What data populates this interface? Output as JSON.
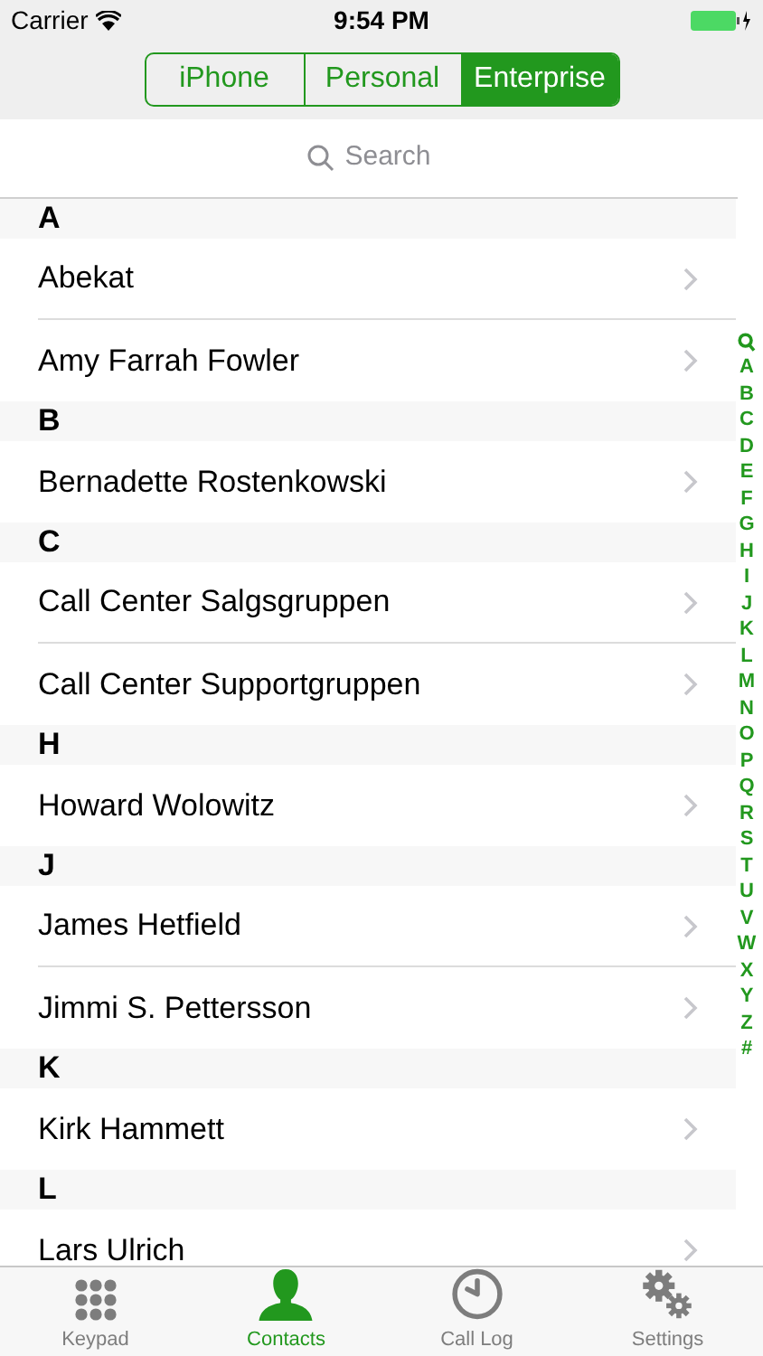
{
  "status_bar": {
    "carrier": "Carrier",
    "time": "9:54 PM"
  },
  "segments": [
    {
      "label": "iPhone",
      "selected": false
    },
    {
      "label": "Personal",
      "selected": false
    },
    {
      "label": "Enterprise",
      "selected": true
    }
  ],
  "search": {
    "placeholder": "Search"
  },
  "sections": [
    {
      "letter": "A",
      "contacts": [
        "Abekat",
        "Amy Farrah Fowler"
      ]
    },
    {
      "letter": "B",
      "contacts": [
        "Bernadette Rostenkowski"
      ]
    },
    {
      "letter": "C",
      "contacts": [
        "Call Center Salgsgruppen",
        "Call Center Supportgruppen"
      ]
    },
    {
      "letter": "H",
      "contacts": [
        "Howard Wolowitz"
      ]
    },
    {
      "letter": "J",
      "contacts": [
        "James Hetfield",
        "Jimmi S. Pettersson"
      ]
    },
    {
      "letter": "K",
      "contacts": [
        "Kirk Hammett"
      ]
    },
    {
      "letter": "L",
      "contacts": [
        "Lars Ulrich"
      ]
    }
  ],
  "index": [
    "A",
    "B",
    "C",
    "D",
    "E",
    "F",
    "G",
    "H",
    "I",
    "J",
    "K",
    "L",
    "M",
    "N",
    "O",
    "P",
    "Q",
    "R",
    "S",
    "T",
    "U",
    "V",
    "W",
    "X",
    "Y",
    "Z",
    "#"
  ],
  "tab_bar": [
    {
      "kind": "keypad",
      "label": "Keypad",
      "selected": false
    },
    {
      "kind": "contacts",
      "label": "Contacts",
      "selected": true
    },
    {
      "kind": "calllog",
      "label": "Call Log",
      "selected": false
    },
    {
      "kind": "settings",
      "label": "Settings",
      "selected": false
    }
  ]
}
